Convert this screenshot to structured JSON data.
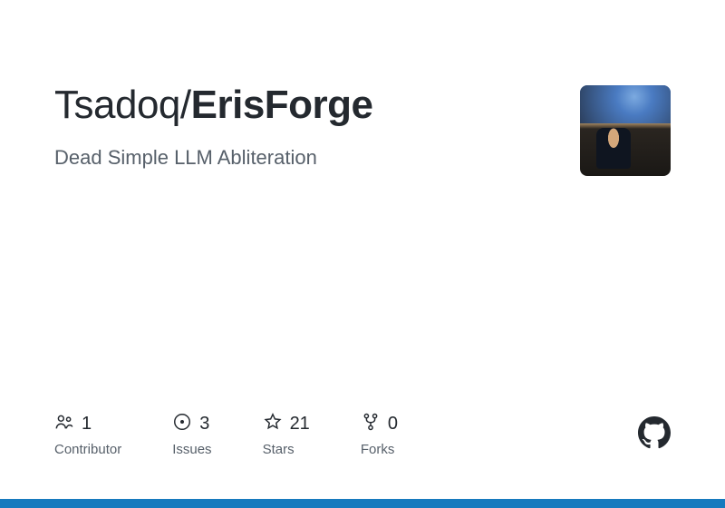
{
  "repo": {
    "owner": "Tsadoq",
    "name": "ErisForge",
    "description": "Dead Simple LLM Abliteration"
  },
  "stats": {
    "contributors": {
      "value": "1",
      "label": "Contributor"
    },
    "issues": {
      "value": "3",
      "label": "Issues"
    },
    "stars": {
      "value": "21",
      "label": "Stars"
    },
    "forks": {
      "value": "0",
      "label": "Forks"
    }
  },
  "colors": {
    "accent": "#167abe"
  }
}
